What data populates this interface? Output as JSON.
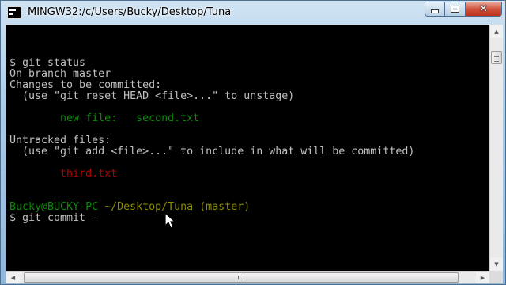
{
  "window": {
    "title": "MINGW32:/c/Users/Bucky/Desktop/Tuna",
    "icon": "terminal-icon"
  },
  "controls": {
    "minimize": "minimize-icon",
    "maximize": "maximize-icon",
    "close": "close-icon",
    "close_glyph": "✕"
  },
  "terminal": {
    "lines": [
      {
        "text": "$ git status",
        "color": "#c0c0c0"
      },
      {
        "text": "On branch master",
        "color": "#c0c0c0"
      },
      {
        "text": "Changes to be committed:",
        "color": "#c0c0c0"
      },
      {
        "text": "  (use \"git reset HEAD <file>...\" to unstage)",
        "color": "#c0c0c0"
      },
      {
        "text": "",
        "color": "#c0c0c0"
      },
      {
        "text": "        new file:   second.txt",
        "color": "#0a8a0a"
      },
      {
        "text": "",
        "color": "#c0c0c0"
      },
      {
        "text": "Untracked files:",
        "color": "#c0c0c0"
      },
      {
        "text": "  (use \"git add <file>...\" to include in what will be committed)",
        "color": "#c0c0c0"
      },
      {
        "text": "",
        "color": "#c0c0c0"
      },
      {
        "text": "        third.txt",
        "color": "#b00000"
      },
      {
        "text": "",
        "color": "#c0c0c0"
      },
      {
        "text": "",
        "color": "#c0c0c0"
      }
    ],
    "prompt": {
      "user_host": "Bucky@BUCKY-PC",
      "path": "~/Desktop/Tuna",
      "branch": "(master)",
      "user_color": "#0a8a0a",
      "path_color": "#8c8c00"
    },
    "current_command": "$ git commit -",
    "background": "#000000",
    "foreground": "#c0c0c0"
  },
  "scrollbars": {
    "up_arrow": "▲",
    "down_arrow": "▼",
    "left_arrow": "◀",
    "right_arrow": "▶"
  }
}
